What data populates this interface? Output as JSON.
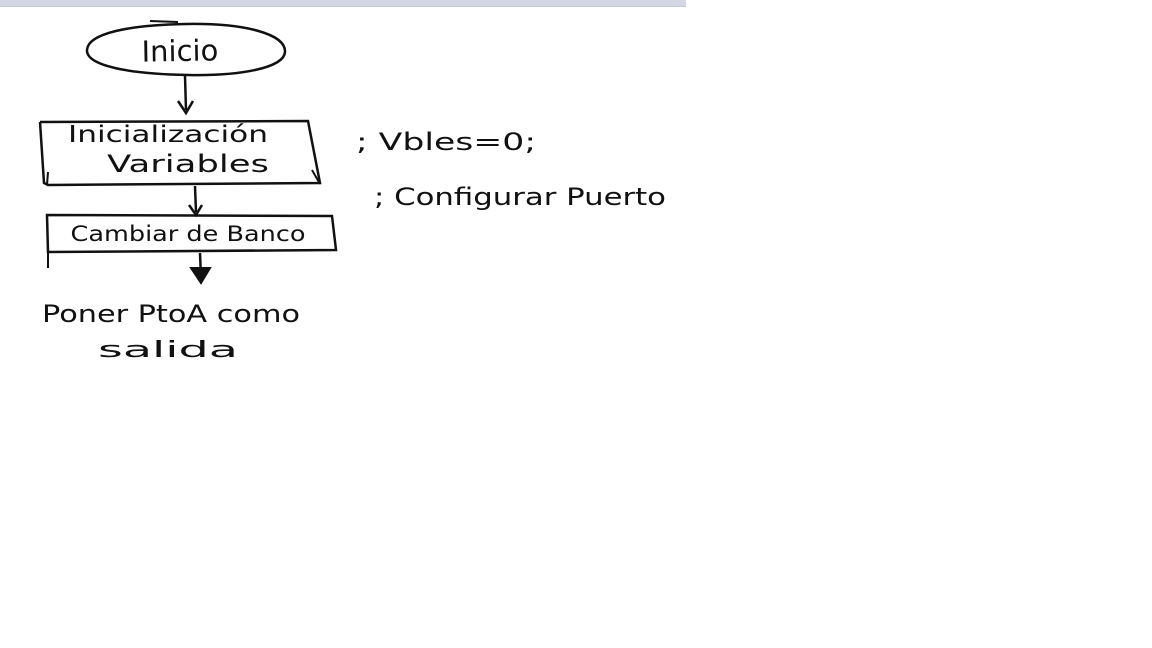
{
  "diagram": {
    "start_label": "Inicio",
    "step1_line1": "Inicialización",
    "step1_line2": "Variables",
    "step2_label": "Cambiar de Banco",
    "step3_line1": "Poner PtoA como",
    "step3_line2": "salida",
    "note1": "; Vbles=0;",
    "note2": "; Configurar Puerto"
  },
  "colors": {
    "ink": "#111111",
    "top_bar": "#d3d7e3"
  }
}
